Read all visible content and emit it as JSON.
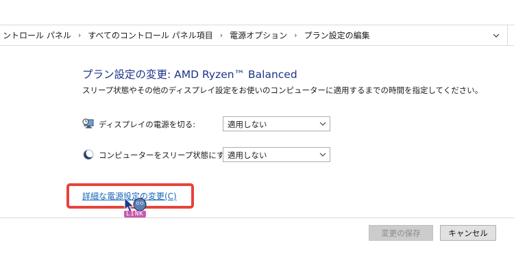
{
  "breadcrumb": {
    "items": [
      "ントロール パネル",
      "すべてのコントロール パネル項目",
      "電源オプション",
      "プラン設定の編集"
    ],
    "separator": "›"
  },
  "page": {
    "title": "プラン設定の変更: AMD Ryzen™ Balanced",
    "description": "スリープ状態やその他のディスプレイ設定をお使いのコンピューターに適用するまでの時間を指定してください。"
  },
  "settings": {
    "display_off": {
      "icon": "monitor-clock-icon",
      "label": "ディスプレイの電源を切る:",
      "value": "適用しない"
    },
    "sleep": {
      "icon": "moon-sleep-icon",
      "label": "コンピューターをスリープ状態にする:",
      "value": "適用しない"
    }
  },
  "advanced_link": {
    "label": "詳細な電源設定の変更(C)"
  },
  "cursor_badge": "LINK",
  "buttons": {
    "save_label": "変更の保存",
    "cancel_label": "キャンセル"
  },
  "colors": {
    "title": "#1e3287",
    "link": "#1565b8",
    "highlight_border": "#e8423a"
  }
}
